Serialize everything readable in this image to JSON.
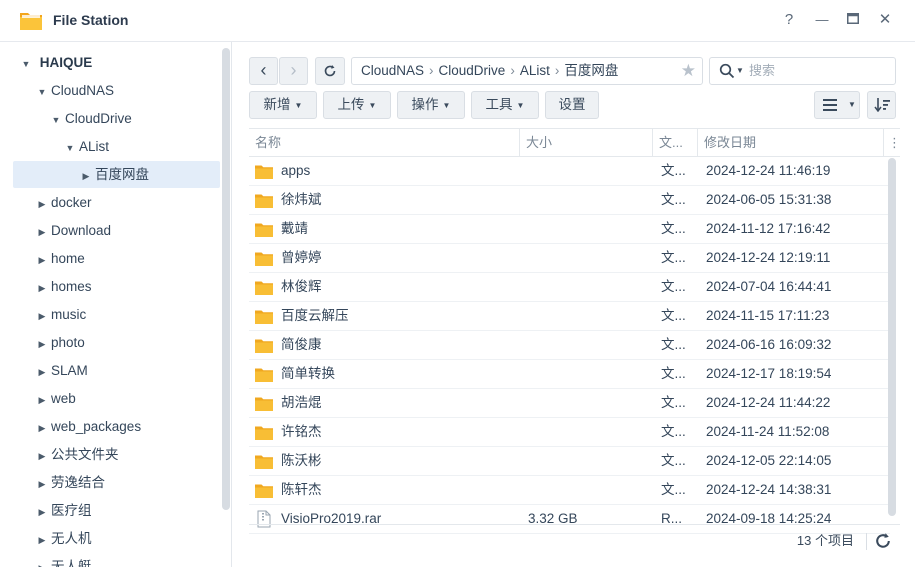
{
  "window": {
    "title": "File Station",
    "help": "?",
    "minimize": "—",
    "maximize": "▭",
    "close": "✕"
  },
  "sidebar": {
    "root": "HAIQUE",
    "items": [
      {
        "label": "CloudNAS",
        "toggle": "▼"
      },
      {
        "label": "CloudDrive",
        "toggle": "▼"
      },
      {
        "label": "AList",
        "toggle": "▼"
      },
      {
        "label": "百度网盘",
        "toggle": "▶"
      },
      {
        "label": "docker",
        "toggle": "▶"
      },
      {
        "label": "Download",
        "toggle": "▶"
      },
      {
        "label": "home",
        "toggle": "▶"
      },
      {
        "label": "homes",
        "toggle": "▶"
      },
      {
        "label": "music",
        "toggle": "▶"
      },
      {
        "label": "photo",
        "toggle": "▶"
      },
      {
        "label": "SLAM",
        "toggle": "▶"
      },
      {
        "label": "web",
        "toggle": "▶"
      },
      {
        "label": "web_packages",
        "toggle": "▶"
      },
      {
        "label": "公共文件夹",
        "toggle": "▶"
      },
      {
        "label": "劳逸结合",
        "toggle": "▶"
      },
      {
        "label": "医疗组",
        "toggle": "▶"
      },
      {
        "label": "无人机",
        "toggle": "▶"
      },
      {
        "label": "无人艇",
        "toggle": "▶"
      }
    ]
  },
  "toolbar": {
    "back": "‹",
    "forward": "›",
    "path": [
      "CloudNAS",
      "CloudDrive",
      "AList",
      "百度网盘"
    ],
    "path_sep": "›",
    "search_placeholder": "搜索",
    "new_label": "新增",
    "upload_label": "上传",
    "action_label": "操作",
    "tools_label": "工具",
    "settings_label": "设置",
    "caret": "▾"
  },
  "table": {
    "headers": {
      "name": "名称",
      "size": "大小",
      "type": "文...",
      "modified": "修改日期"
    },
    "rows": [
      {
        "name": "apps",
        "size": "",
        "type": "文...",
        "modified": "2024-12-24 11:46:19",
        "kind": "folder"
      },
      {
        "name": "徐炜斌",
        "size": "",
        "type": "文...",
        "modified": "2024-06-05 15:31:38",
        "kind": "folder"
      },
      {
        "name": "戴靖",
        "size": "",
        "type": "文...",
        "modified": "2024-11-12 17:16:42",
        "kind": "folder"
      },
      {
        "name": "曾婷婷",
        "size": "",
        "type": "文...",
        "modified": "2024-12-24 12:19:11",
        "kind": "folder"
      },
      {
        "name": "林俊辉",
        "size": "",
        "type": "文...",
        "modified": "2024-07-04 16:44:41",
        "kind": "folder"
      },
      {
        "name": "百度云解压",
        "size": "",
        "type": "文...",
        "modified": "2024-11-15 17:11:23",
        "kind": "folder"
      },
      {
        "name": "简俊康",
        "size": "",
        "type": "文...",
        "modified": "2024-06-16 16:09:32",
        "kind": "folder"
      },
      {
        "name": "简单转换",
        "size": "",
        "type": "文...",
        "modified": "2024-12-17 18:19:54",
        "kind": "folder"
      },
      {
        "name": "胡浩焜",
        "size": "",
        "type": "文...",
        "modified": "2024-12-24 11:44:22",
        "kind": "folder"
      },
      {
        "name": "许铭杰",
        "size": "",
        "type": "文...",
        "modified": "2024-11-24 11:52:08",
        "kind": "folder"
      },
      {
        "name": "陈沃彬",
        "size": "",
        "type": "文...",
        "modified": "2024-12-05 22:14:05",
        "kind": "folder"
      },
      {
        "name": "陈轩杰",
        "size": "",
        "type": "文...",
        "modified": "2024-12-24 14:38:31",
        "kind": "folder"
      },
      {
        "name": "VisioPro2019.rar",
        "size": "3.32 GB",
        "type": "R...",
        "modified": "2024-09-18 14:25:24",
        "kind": "file"
      }
    ]
  },
  "status": {
    "count": "13 个项目"
  },
  "colors": {
    "folder": "#f6b72a",
    "selection": "#e3edf9",
    "accent": "#2e7bd6"
  }
}
